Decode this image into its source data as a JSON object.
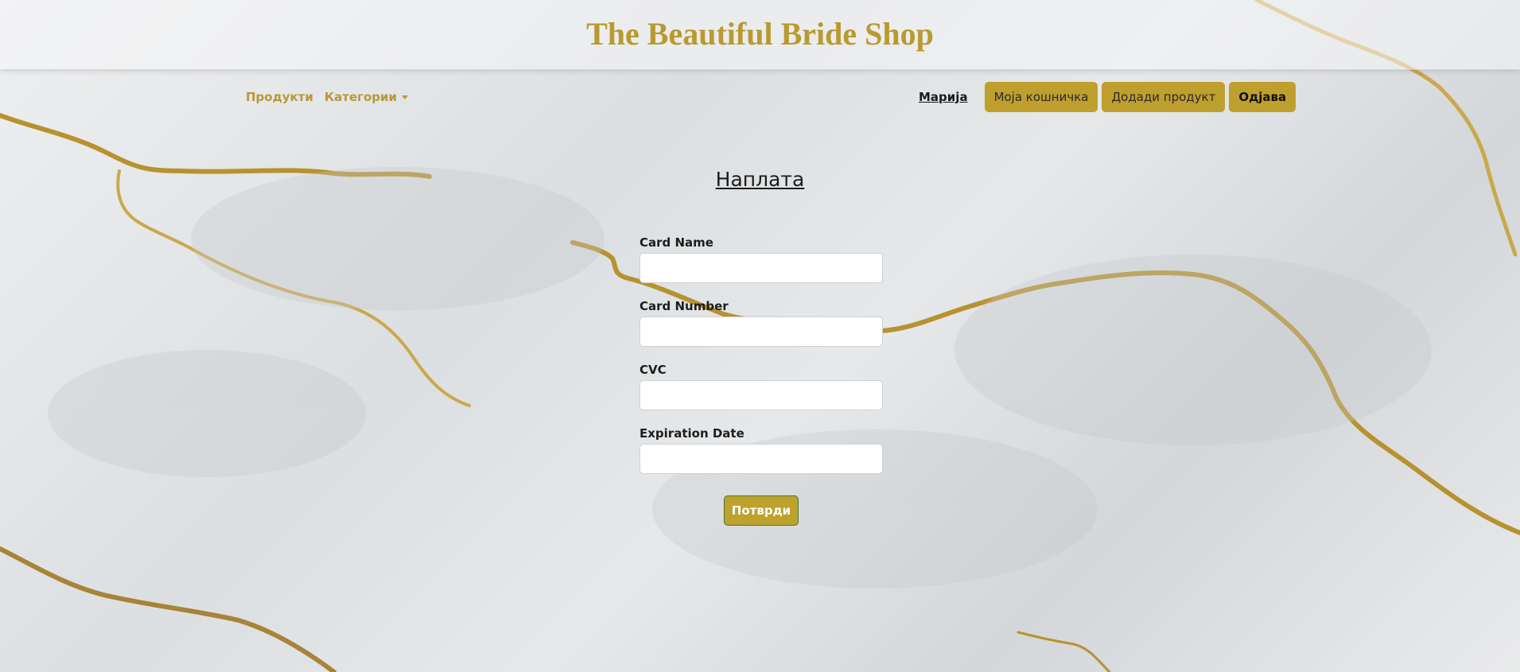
{
  "header": {
    "site_title": "The Beautiful Bride Shop"
  },
  "nav": {
    "products_label": "Продукти",
    "categories_label": "Категории",
    "user_name": "Марија",
    "cart_label": "Моја кошничка",
    "add_product_label": "Додади продукт",
    "logout_label": "Одјава"
  },
  "page": {
    "heading": "Наплата"
  },
  "form": {
    "card_name_label": "Card Name",
    "card_name_value": "",
    "card_number_label": "Card Number",
    "card_number_value": "",
    "cvc_label": "CVC",
    "cvc_value": "",
    "expiration_label": "Expiration Date",
    "expiration_value": "",
    "submit_label": "Потврди"
  },
  "colors": {
    "accent_gold": "#bf9f2e",
    "title_gold": "#b89a2f",
    "submit_border": "#3d7a2e"
  }
}
